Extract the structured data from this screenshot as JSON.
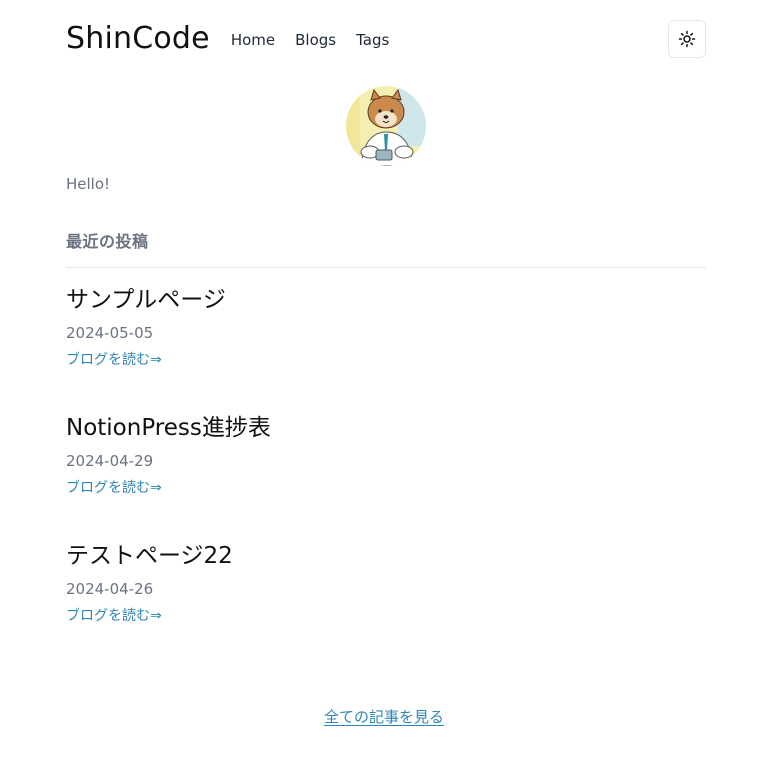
{
  "header": {
    "brand": "ShinCode",
    "nav": [
      "Home",
      "Blogs",
      "Tags"
    ],
    "theme_toggle_icon": "sun-icon"
  },
  "profile": {
    "intro": "Hello!"
  },
  "recent": {
    "heading": "最近の投稿",
    "posts": [
      {
        "title": "サンプルページ",
        "date": "2024-05-05",
        "link_label": "ブログを読む⇒"
      },
      {
        "title": "NotionPress進捗表",
        "date": "2024-04-29",
        "link_label": "ブログを読む⇒"
      },
      {
        "title": "テストページ22",
        "date": "2024-04-26",
        "link_label": "ブログを読む⇒"
      }
    ]
  },
  "footer": {
    "all_posts_label": "全ての記事を見る"
  },
  "colors": {
    "link": "#2f86b4",
    "muted_text": "#6b7280",
    "divider": "#e5e7eb"
  }
}
